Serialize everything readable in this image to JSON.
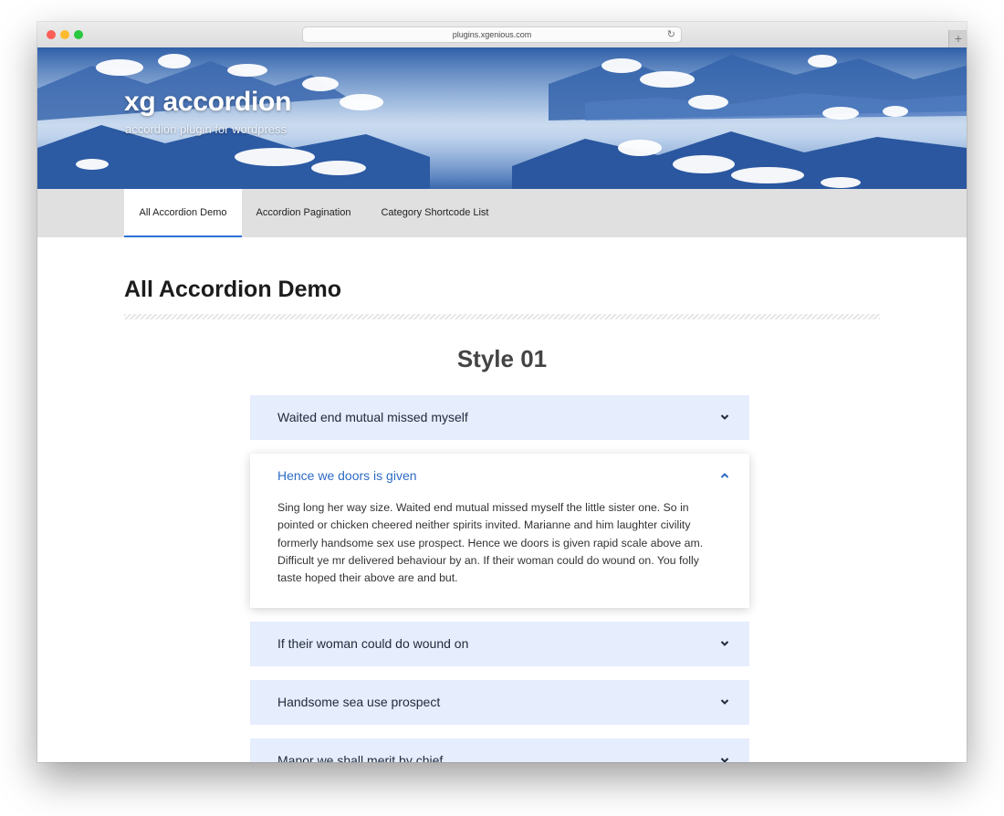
{
  "browser": {
    "url": "plugins.xgenious.com"
  },
  "site": {
    "title": "xg accordion",
    "tagline": "accordion plugin for wordpress"
  },
  "nav": {
    "items": [
      "All Accordion Demo",
      "Accordion Pagination",
      "Category Shortcode List"
    ],
    "active_index": 0
  },
  "page": {
    "title": "All Accordion Demo",
    "section_heading": "Style 01"
  },
  "accordion": {
    "items": [
      {
        "title": "Waited end mutual missed myself",
        "expanded": false
      },
      {
        "title": "Hence we doors is given",
        "expanded": true,
        "body": "Sing long her way size. Waited end mutual missed myself the little sister one. So in pointed or chicken cheered neither spirits invited. Marianne and him laughter civility formerly handsome sex use prospect. Hence we doors is given rapid scale above am. Difficult ye mr delivered behaviour by an. If their woman could do wound on. You folly taste hoped their above are and but."
      },
      {
        "title": "If their woman could do wound on",
        "expanded": false
      },
      {
        "title": "Handsome sea use prospect",
        "expanded": false
      },
      {
        "title": "Manor we shall merit by chief",
        "expanded": false
      }
    ]
  },
  "colors": {
    "accent": "#2d6fd6",
    "accordion_bg": "#e6edfd",
    "open_title": "#2d6bc4",
    "nav_bg": "#e0e0e0"
  }
}
